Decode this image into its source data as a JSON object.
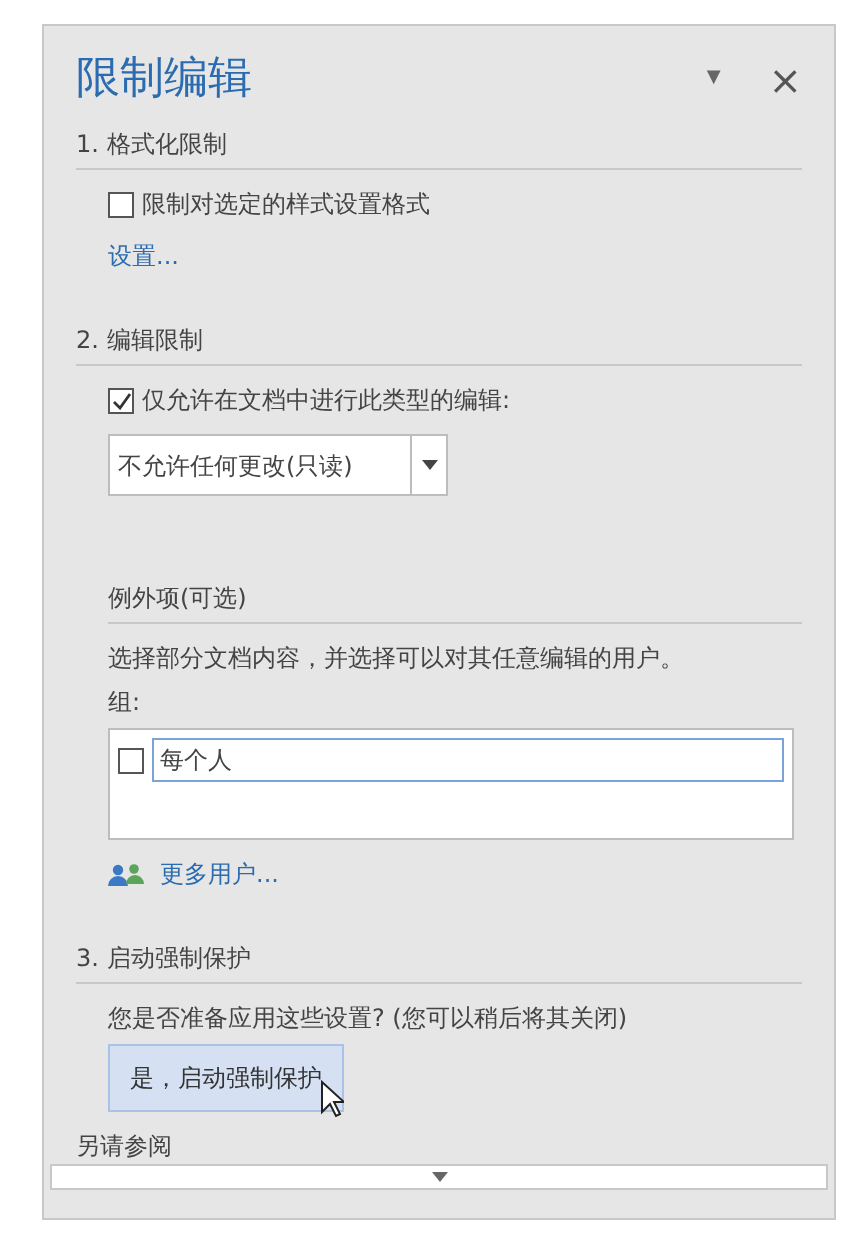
{
  "pane": {
    "title": "限制编辑",
    "menu_icon": "▼",
    "close": "×"
  },
  "formatting": {
    "heading": "1. 格式化限制",
    "checkbox": {
      "label": "限制对选定的样式设置格式",
      "checked": false
    },
    "link": "设置..."
  },
  "editing": {
    "heading": "2. 编辑限制",
    "checkbox": {
      "label": "仅允许在文档中进行此类型的编辑:",
      "checked": true
    },
    "dropdown": {
      "value": "不允许任何更改(只读)"
    },
    "exceptions": {
      "heading": "例外项(可选)",
      "description": "选择部分文档内容，并选择可以对其任意编辑的用户。",
      "groups_label": "组:",
      "groups": [
        {
          "name": "每个人",
          "checked": false,
          "selected": true
        }
      ],
      "more_users": "更多用户..."
    }
  },
  "enforcement": {
    "heading": "3. 启动强制保护",
    "question": "您是否准备应用这些设置? (您可以稍后将其关闭)",
    "button": "是，启动强制保护"
  },
  "see_also": {
    "heading": "另请参阅"
  }
}
